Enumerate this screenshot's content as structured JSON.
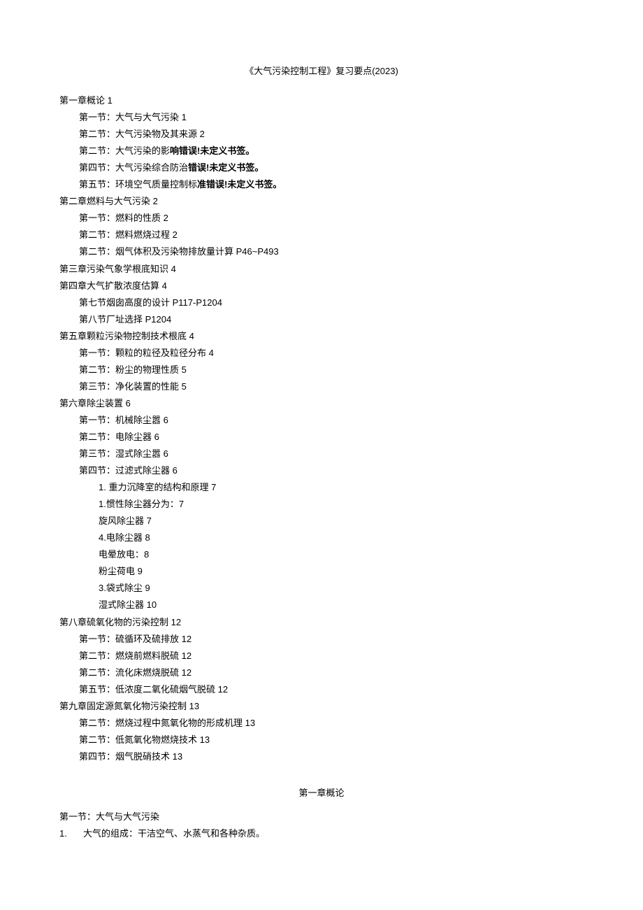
{
  "title": "《大气污染控制工程》复习要点(2023)",
  "toc": [
    {
      "level": 0,
      "text": "第一章概论 1"
    },
    {
      "level": 1,
      "text": "第一节：大气与大气污染 1"
    },
    {
      "level": 1,
      "text": "第二节：大气污染物及其来源 2"
    },
    {
      "level": 1,
      "prefix": "第二节：大气污染的影",
      "bold": "响错误!未定义书签。"
    },
    {
      "level": 1,
      "prefix": "第四节：大气污染综合防治",
      "bold": "错误!未定义书签。"
    },
    {
      "level": 1,
      "prefix": "第五节：环境空气质量控制标",
      "bold": "准错误!未定义书签。"
    },
    {
      "level": 0,
      "text": "第二章燃料与大气污染 2"
    },
    {
      "level": 1,
      "text": "第一节：燃料的性质 2"
    },
    {
      "level": 1,
      "text": "第二节：燃料燃烧过程 2"
    },
    {
      "level": 1,
      "text": "第二节：烟气体积及污染物排放量计算 P46~P493"
    },
    {
      "level": 0,
      "text": "第三章污染气象学根底知识 4"
    },
    {
      "level": 0,
      "text": "第四章大气扩散浓度估算 4"
    },
    {
      "level": 1,
      "text": "第七节烟囱高度的设计 P117-P1204"
    },
    {
      "level": 1,
      "text": "第八节厂址选择 P1204"
    },
    {
      "level": 0,
      "text": "第五章颗粒污染物控制技术根底 4"
    },
    {
      "level": 1,
      "text": "第一节：颗粒的粒径及粒径分布 4"
    },
    {
      "level": 1,
      "text": "第二节：粉尘的物理性质 5"
    },
    {
      "level": 1,
      "text": "第三节：净化装置的性能 5"
    },
    {
      "level": 0,
      "text": "第六章除尘装置 6"
    },
    {
      "level": 1,
      "text": "第一节：机械除尘嚣 6"
    },
    {
      "level": 1,
      "text": "第二节：电除尘器 6"
    },
    {
      "level": 1,
      "text": "第三节：湿式除尘嚣 6"
    },
    {
      "level": 1,
      "text": "第四节：过滤式除尘器 6"
    },
    {
      "level": 2,
      "text": "1. 重力沉降室的结构和原理 7"
    },
    {
      "level": 2,
      "text": "1.惯性除尘器分为：7"
    },
    {
      "level": 2,
      "text": "旋风除尘器 7"
    },
    {
      "level": 2,
      "text": "4.电除尘器 8"
    },
    {
      "level": 2,
      "text": "电晕放电：8"
    },
    {
      "level": 2,
      "text": "粉尘荷电 9"
    },
    {
      "level": 2,
      "text": "3.袋式除尘 9"
    },
    {
      "level": 2,
      "text": "湿式除尘器 10"
    },
    {
      "level": 0,
      "text": "第八章硫氧化物的污染控制 12"
    },
    {
      "level": 1,
      "text": "第一节：硫循环及硫排放 12"
    },
    {
      "level": 1,
      "text": "第二节：燃烧前燃料脱硫 12"
    },
    {
      "level": 1,
      "text": "第二节：流化床燃烧脱硫 12"
    },
    {
      "level": 1,
      "text": "第五节：低浓度二氧化硫烟气脱硫 12"
    },
    {
      "level": 0,
      "text": "第九章固定源氮氧化物污染控制 13"
    },
    {
      "level": 1,
      "text": "第二节：燃烧过程中氮氧化物的形成机理 13"
    },
    {
      "level": 1,
      "text": "第二节：低氮氧化物燃烧技术 13"
    },
    {
      "level": 1,
      "text": "第四节：烟气脱硝技术 13"
    }
  ],
  "body": {
    "chapter_heading": "第一章概论",
    "section_heading": "第一节：大气与大气污染",
    "items": [
      {
        "num": "1.",
        "text": "大气的组成：干洁空气、水蒸气和各种杂质。"
      }
    ]
  }
}
